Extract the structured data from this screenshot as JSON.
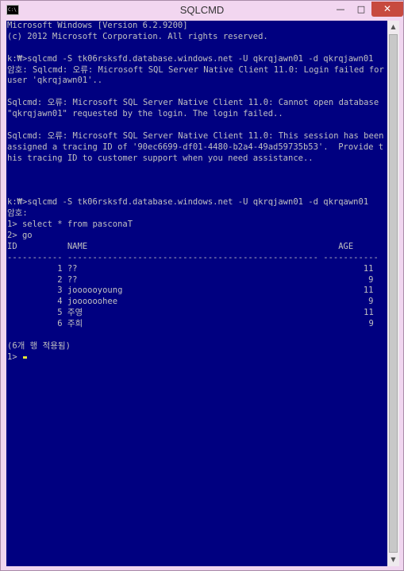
{
  "window": {
    "title": "SQLCMD",
    "icon_label": "C:\\",
    "buttons": {
      "minimize": "—",
      "maximize": "□",
      "close": "✕"
    }
  },
  "console": {
    "background": "#000080",
    "foreground": "#c0c0c0",
    "cursor_color": "#e6e633",
    "lines": [
      "Microsoft Windows [Version 6.2.9200]",
      "(c) 2012 Microsoft Corporation. All rights reserved.",
      "",
      "k:₩>sqlcmd -S tk06rsksfd.database.windows.net -U qkrqjawn01 -d qkrqjawn01",
      "암호: Sqlcmd: 오류: Microsoft SQL Server Native Client 11.0: Login failed for user 'qkrqjawn01'..",
      "",
      "Sqlcmd: 오류: Microsoft SQL Server Native Client 11.0: Cannot open database \"qkrqjawn01\" requested by the login. The login failed..",
      "",
      "Sqlcmd: 오류: Microsoft SQL Server Native Client 11.0: This session has been assigned a tracing ID of '90ec6699-df01-4480-b2a4-49ad59735b53'.  Provide this tracing ID to customer support when you need assistance..",
      "",
      "",
      "",
      "k:₩>sqlcmd -S tk06rsksfd.database.windows.net -U qkrqjawn01 -d qkrqawn01",
      "암호:",
      "1> select * from pasconaT",
      "2> go",
      "ID          NAME                                                  AGE",
      "----------- -------------------------------------------------- -----------",
      "          1 ??                                                         11",
      "          2 ??                                                          9",
      "          3 joooooyoung                                                11",
      "          4 joooooohee                                                  9",
      "          5 주영                                                        11",
      "          6 주희                                                         9",
      "",
      "(6개 행 적용됨)",
      "1> "
    ]
  },
  "scrollbar": {
    "up_arrow": "▲",
    "down_arrow": "▼"
  }
}
